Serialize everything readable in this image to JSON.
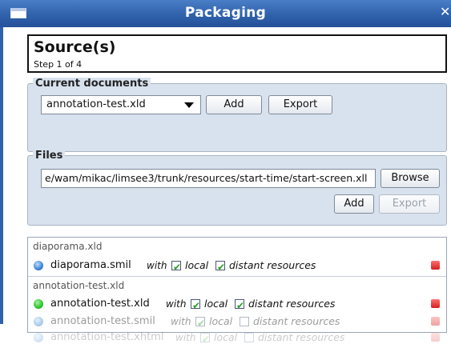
{
  "window": {
    "title": "Packaging",
    "close_glyph": "✕"
  },
  "header": {
    "title": "Source(s)",
    "step": "Step 1 of 4"
  },
  "current_documents": {
    "legend": "Current documents",
    "selected": "annotation-test.xld",
    "add_label": "Add",
    "export_label": "Export"
  },
  "files": {
    "legend": "Files",
    "path": "e/wam/mikac/limsee3/trunk/resources/start-time/start-screen.xll",
    "browse_label": "Browse",
    "add_label": "Add",
    "export_label": "Export"
  },
  "list": {
    "groups": [
      {
        "name": "diaporama.xld",
        "rows": [
          {
            "file": "diaporama.smil",
            "with": "with",
            "local": "local",
            "distant": "distant resources",
            "icon": "blue-ball-icon"
          }
        ]
      },
      {
        "name": "annotation-test.xld",
        "rows": [
          {
            "file": "annotation-test.xld",
            "with": "with",
            "local": "local",
            "distant": "distant resources",
            "icon": "green-ball-icon"
          },
          {
            "file": "annotation-test.smil",
            "with": "with",
            "local": "local",
            "distant": "distant resources",
            "icon": "blue-ball-icon"
          },
          {
            "file": "annotation-test.xhtml",
            "with": "with",
            "local": "local",
            "distant": "distant resources",
            "icon": "blue-ball-icon"
          }
        ]
      }
    ]
  }
}
